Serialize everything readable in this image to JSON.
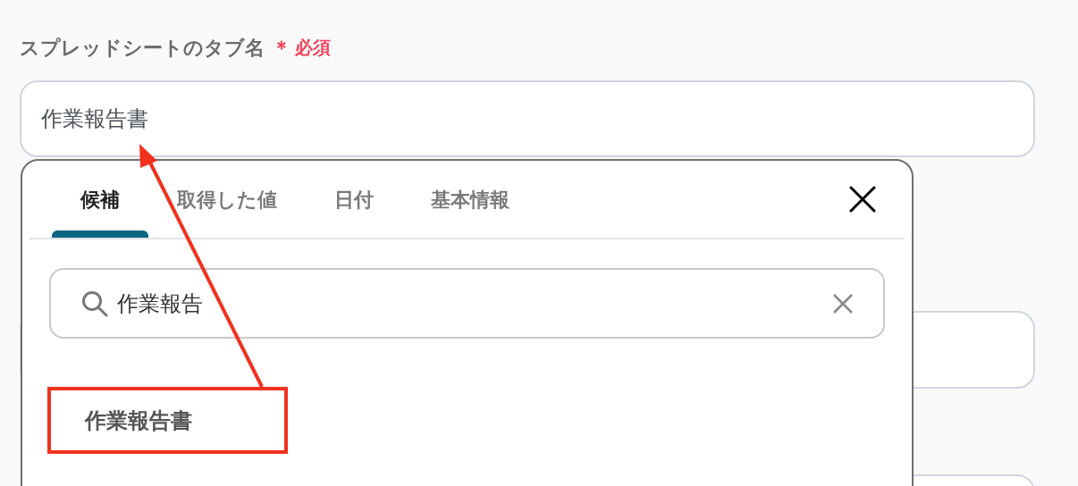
{
  "field": {
    "label": "スプレッドシートのタブ名",
    "required_mark": "＊",
    "required_text": "必須",
    "value": "作業報告書"
  },
  "popup": {
    "tabs": [
      {
        "label": "候補",
        "selected": true
      },
      {
        "label": "取得した値",
        "selected": false
      },
      {
        "label": "日付",
        "selected": false
      },
      {
        "label": "基本情報",
        "selected": false
      }
    ],
    "search": {
      "value": "作業報告"
    },
    "results": [
      "作業報告書"
    ]
  }
}
